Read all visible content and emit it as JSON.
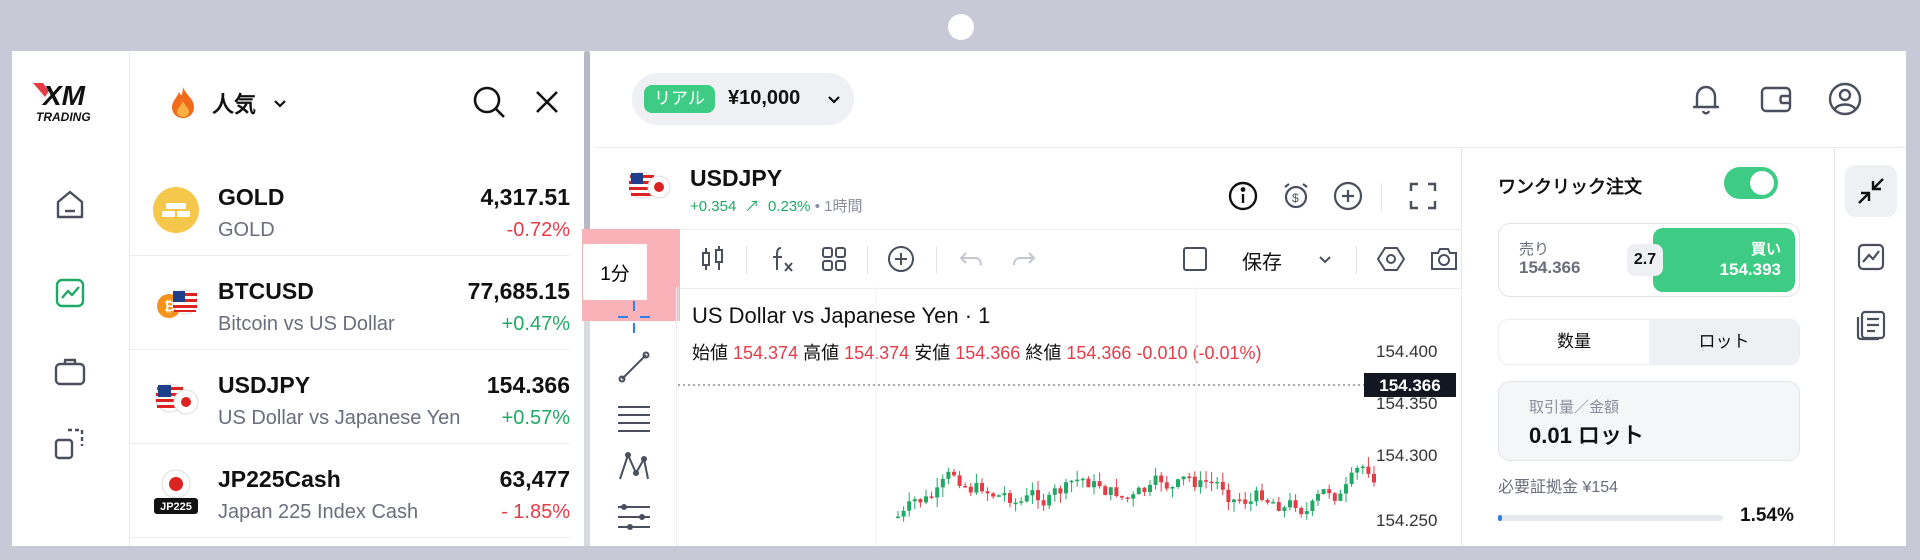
{
  "brand": {
    "logo_main": "XM",
    "logo_sub": "TRADING"
  },
  "watchlist": {
    "title": "人気",
    "items": [
      {
        "symbol": "GOLD",
        "desc": "GOLD",
        "price": "4,317.51",
        "change": "-0.72%",
        "dir": "neg"
      },
      {
        "symbol": "BTCUSD",
        "desc": "Bitcoin vs US Dollar",
        "price": "77,685.15",
        "change": "+0.47%",
        "dir": "pos"
      },
      {
        "symbol": "USDJPY",
        "desc": "US Dollar vs Japanese Yen",
        "price": "154.366",
        "change": "+0.57%",
        "dir": "pos"
      },
      {
        "symbol": "JP225Cash",
        "desc": "Japan 225 Index Cash",
        "price": "63,477",
        "change": "- 1.85%",
        "dir": "neg",
        "badge": "JP225"
      }
    ]
  },
  "account": {
    "badge": "リアル",
    "balance": "¥10,000"
  },
  "chart": {
    "symbol": "USDJPY",
    "change_abs": "+0.354",
    "change_pct": "0.23%",
    "timeframe": "• 1時間",
    "tf_button": "1分",
    "save_label": "保存",
    "title": "US Dollar vs Japanese Yen · 1",
    "ohlc": {
      "open_label": "始値",
      "open": "154.374",
      "high_label": "高値",
      "high": "154.374",
      "low_label": "安値",
      "low": "154.366",
      "close_label": "終値",
      "close": "154.366",
      "change": "-0.010 (-0.01%)"
    },
    "price_axis": [
      "154.400",
      "154.350",
      "154.300",
      "154.250"
    ],
    "current_price": "154.366"
  },
  "chart_data": {
    "type": "candlestick",
    "price_axis_ticks": [
      154.4,
      154.35,
      154.3,
      154.25
    ],
    "current_price": 154.366,
    "colors": {
      "up": "#1fa965",
      "down": "#e53c48"
    }
  },
  "order_panel": {
    "one_click_label": "ワンクリック注文",
    "one_click_on": true,
    "sell_label": "売り",
    "sell_price": "154.366",
    "spread": "2.7",
    "buy_label": "買い",
    "buy_price": "154.393",
    "seg_volume": "数量",
    "seg_lot": "ロット",
    "qty_label": "取引量／金額",
    "qty_value": "0.01 ロット",
    "margin_label": "必要証拠金 ¥154",
    "margin_pct": "1.54%",
    "margin_fraction": 0.0154
  },
  "colors": {
    "accent_green": "#3ecb83",
    "negative": "#e53c48",
    "positive": "#1fa965",
    "highlight": "#f9b3b8"
  }
}
